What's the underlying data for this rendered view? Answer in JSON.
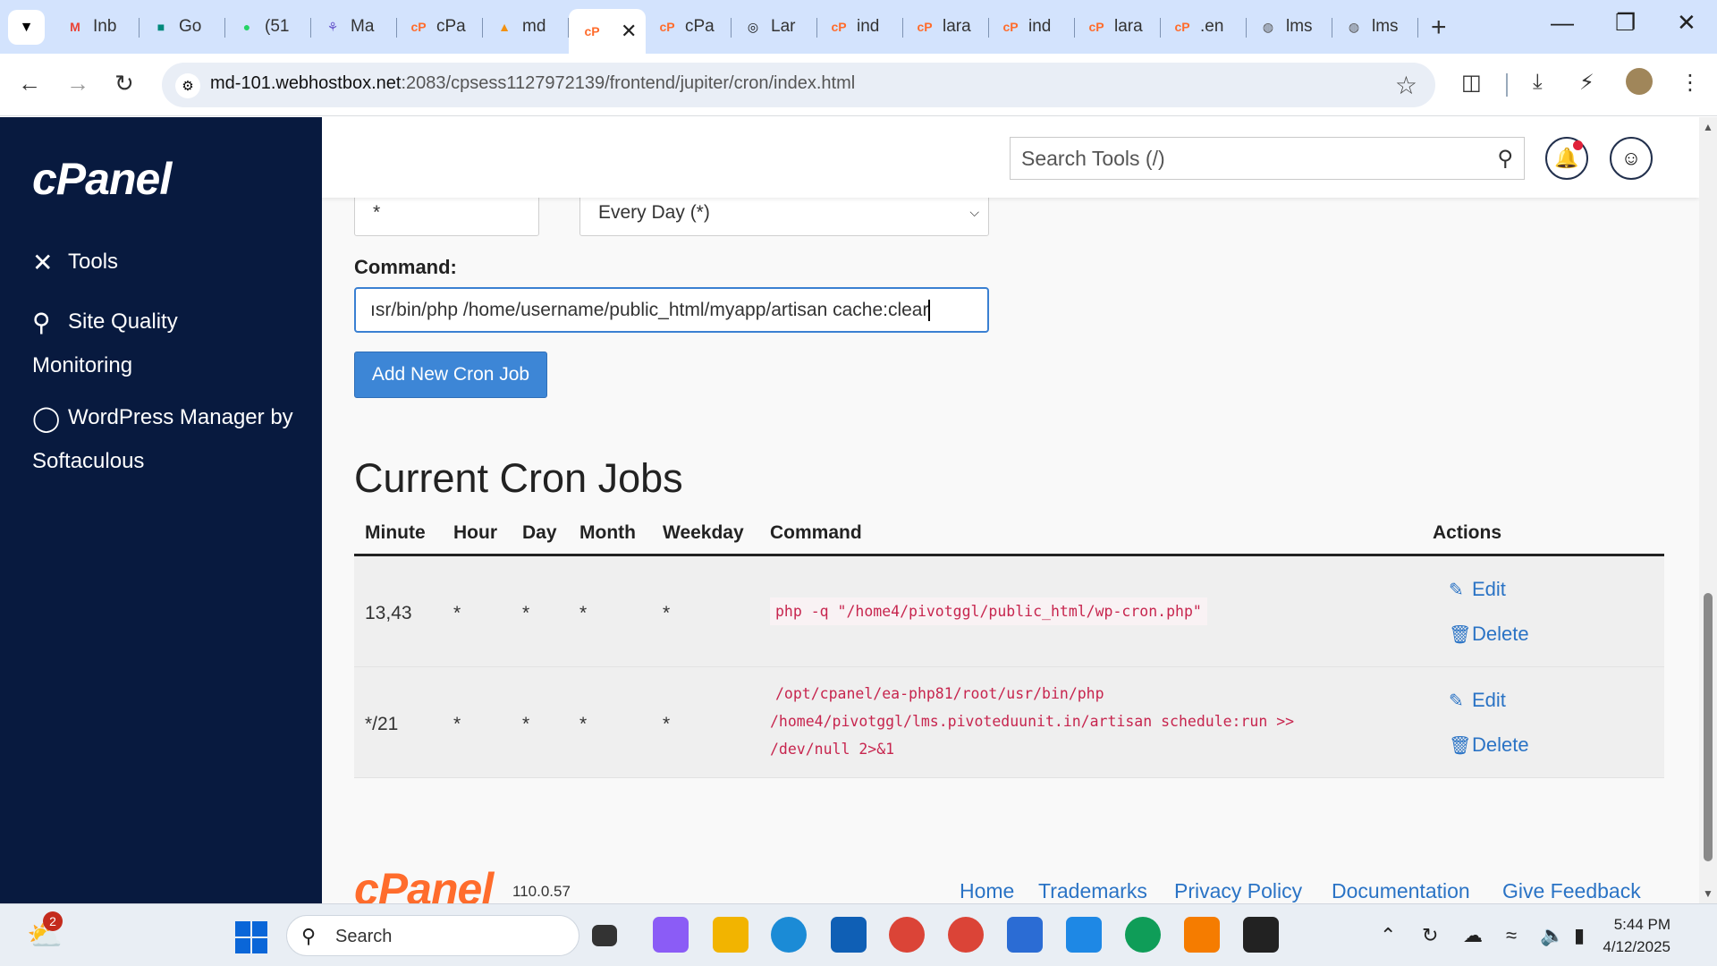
{
  "browser": {
    "tabs": [
      {
        "title": "Inb",
        "icon": "gmail-icon"
      },
      {
        "title": "Go",
        "icon": "meet-icon"
      },
      {
        "title": "(51",
        "icon": "whatsapp-icon"
      },
      {
        "title": "Ma",
        "icon": "app-icon"
      },
      {
        "title": "cPa",
        "icon": "cpanel-icon"
      },
      {
        "title": "md",
        "icon": "phpmyadmin-icon"
      },
      {
        "title": "",
        "icon": "cpanel-icon",
        "active": true
      },
      {
        "title": "cPa",
        "icon": "cpanel-icon"
      },
      {
        "title": "Lar",
        "icon": "openai-icon"
      },
      {
        "title": "ind",
        "icon": "cpanel-icon"
      },
      {
        "title": "lara",
        "icon": "cpanel-icon"
      },
      {
        "title": "ind",
        "icon": "cpanel-icon"
      },
      {
        "title": "lara",
        "icon": "cpanel-icon"
      },
      {
        "title": ".en",
        "icon": "cpanel-icon"
      },
      {
        "title": "lms",
        "icon": "globe-icon"
      },
      {
        "title": "lms",
        "icon": "globe-icon"
      }
    ],
    "url_host": "md-101.webhostbox.net",
    "url_rest": ":2083/cpsess1127972139/frontend/jupiter/cron/index.html"
  },
  "cpanel": {
    "logo": "cPanel",
    "nav": [
      {
        "label": "Tools"
      },
      {
        "label": "Site Quality Monitoring"
      },
      {
        "label": "WordPress Manager by Softaculous"
      }
    ],
    "search_placeholder": "Search Tools (/)",
    "minute_value": "*",
    "weekday_selected": "Every Day (*)",
    "command_label": "Command:",
    "command_value": "ısr/bin/php /home/username/public_html/myapp/artisan cache:clear",
    "add_button": "Add New Cron Job",
    "jobs_title": "Current Cron Jobs",
    "columns": [
      "Minute",
      "Hour",
      "Day",
      "Month",
      "Weekday",
      "Command",
      "Actions"
    ],
    "jobs": [
      {
        "minute": "13,43",
        "hour": "*",
        "day": "*",
        "month": "*",
        "weekday": "*",
        "command_lines": [
          "php -q \"/home4/pivotggl/public_html/wp-cron.php\""
        ]
      },
      {
        "minute": "*/21",
        "hour": "*",
        "day": "*",
        "month": "*",
        "weekday": "*",
        "command_lines": [
          "/opt/cpanel/ea-php81/root/usr/bin/php",
          "/home4/pivotggl/lms.pivoteduunit.in/artisan schedule:run >>",
          "/dev/null 2>&1"
        ]
      }
    ],
    "edit_label": "Edit",
    "delete_label": "Delete",
    "footer_logo": "cPanel",
    "version": "110.0.57",
    "footer_links": [
      "Home",
      "Trademarks",
      "Privacy Policy",
      "Documentation",
      "Give Feedback"
    ]
  },
  "taskbar": {
    "weather_badge": "2",
    "search_label": "Search",
    "time": "5:44 PM",
    "date": "4/12/2025"
  },
  "colors": {
    "sidebar_bg": "#081a3f",
    "accent_blue": "#3d86d6",
    "cpanel_orange": "#ff6c2c",
    "code_red": "#c7254e"
  }
}
